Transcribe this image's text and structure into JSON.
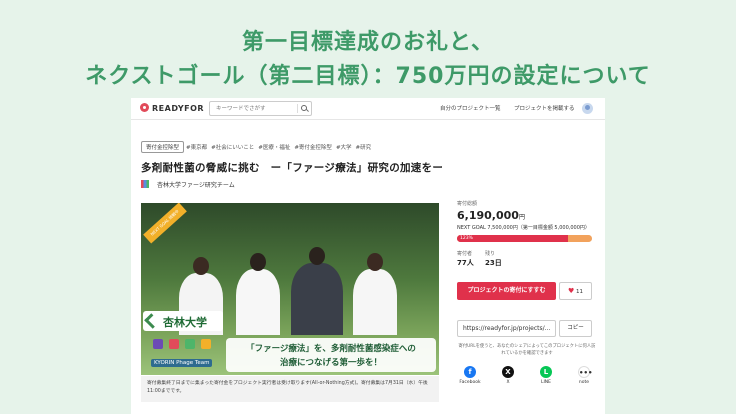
{
  "headline": {
    "line1": "第一目標達成のお礼と、",
    "line2": "ネクストゴール（第二目標）：750万円の設定について"
  },
  "nav": {
    "logo": "READYFOR",
    "search_placeholder": "キーワードでさがす",
    "link_my_projects": "自分のプロジェクト一覧",
    "link_publish": "プロジェクトを掲載する"
  },
  "project": {
    "category": "寄付金控除型",
    "tags": [
      "#東京都",
      "#社会にいいこと",
      "#医療・福祉",
      "#寄付金控除型",
      "#大学",
      "#研究"
    ],
    "title": "多剤耐性菌の脅威に挑む　ー「ファージ療法」研究の加速をー",
    "team": "杏林大学ファージ研究チーム"
  },
  "hero": {
    "ribbon": "NEXT GOAL 挑戦中",
    "university": "杏林大学",
    "phage_team": "KYORIN Phage Team",
    "caption_line1": "「ファージ療法」を、多剤耐性菌感染症への",
    "caption_line2": "治療につなげる第一歩を！"
  },
  "notice": "寄付募集終了日までに集まった寄付金をプロジェクト実行者は受け取ります(All-or-Nothing方式)。寄付募集は7月31日（水）午後11:00までです。",
  "sidebar": {
    "total_label": "寄付総額",
    "total_amount": "6,190,000",
    "currency": "円",
    "next_goal": "NEXT GOAL 7,500,000円（第一目標金額 5,000,000円）",
    "progress_label": "123%",
    "progress_first_goal": 1.0,
    "progress_next_goal": 0.825,
    "supporters_label": "寄付者",
    "supporters_value": "77人",
    "remaining_label": "残り",
    "remaining_value": "23日",
    "support_button": "プロジェクトの寄付にすすむ",
    "favorite_count": "11",
    "share_url": "https://readyfor.jp/projects/...",
    "copy_button": "コピー",
    "share_note": "寄付URLを使うと、あなたのシェアによってこのプロジェクトに何人訪れているかを確認できます",
    "sns": [
      {
        "label": "Facebook",
        "icon": "facebook-icon",
        "color": "#1877f2",
        "glyph": "f"
      },
      {
        "label": "X",
        "icon": "x-icon",
        "color": "#111111",
        "glyph": "X"
      },
      {
        "label": "LINE",
        "icon": "line-icon",
        "color": "#06c755",
        "glyph": "L"
      },
      {
        "label": "note",
        "icon": "note-icon",
        "color": "#ffffff",
        "glyph": "•••"
      }
    ]
  },
  "colors": {
    "background": "#e6f3ea",
    "headline": "#3e9a68",
    "accent": "#e0314b",
    "next_goal_fill": "#f2a25c"
  }
}
